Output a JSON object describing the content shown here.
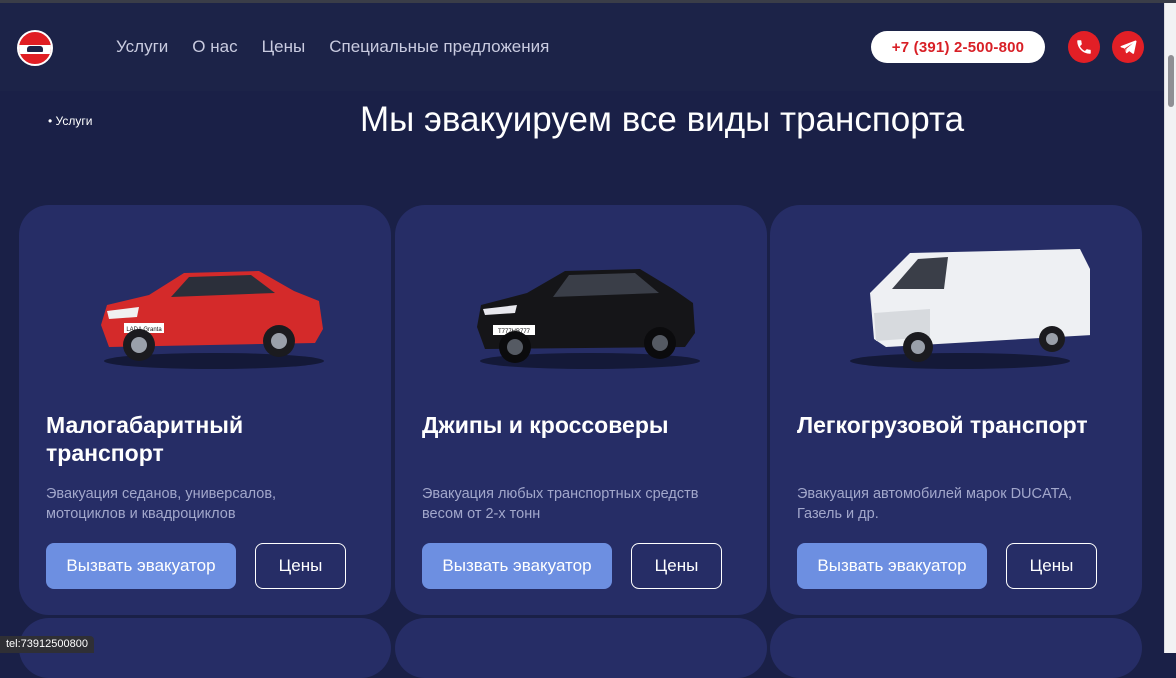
{
  "header": {
    "nav": [
      "Услуги",
      "О нас",
      "Цены",
      "Специальные предложения"
    ],
    "phone": "+7 (391) 2-500-800"
  },
  "breadcrumb": "• Услуги",
  "page_title": "Мы эвакуируем все виды транспорта",
  "cards": [
    {
      "title": "Малогабаритный транспорт",
      "description": "Эвакуация седанов, универсалов, мотоциклов и квадроциклов",
      "call_label": "Вызвать эвакуатор",
      "prices_label": "Цены",
      "car_plate": "LADA Granta"
    },
    {
      "title": "Джипы и кроссоверы",
      "description": "Эвакуация любых транспортных средств весом от 2-х тонн",
      "call_label": "Вызвать эвакуатор",
      "prices_label": "Цены",
      "car_plate": "Т777НВ777"
    },
    {
      "title": "Легкогрузовой транспорт",
      "description": "Эвакуация автомобилей марок DUCATA, Газель и др.",
      "call_label": "Вызвать эвакуатор",
      "prices_label": "Цены"
    }
  ],
  "status_bar": "tel:73912500800",
  "colors": {
    "background": "#1a2047",
    "card": "#262d66",
    "primary_button": "#6d8fe1",
    "accent_red": "#e21f26"
  },
  "icons": [
    "logo",
    "phone-icon",
    "telegram-icon"
  ]
}
